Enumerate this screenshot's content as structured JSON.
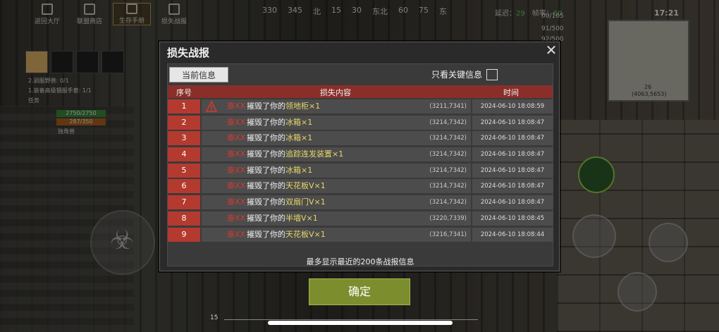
{
  "nav": {
    "items": [
      {
        "label": "返回大厅"
      },
      {
        "label": "联盟商店"
      },
      {
        "label": "生存手册",
        "active": true
      },
      {
        "label": "损失战报"
      }
    ]
  },
  "compass": [
    "330",
    "345",
    "北",
    "15",
    "30",
    "东北",
    "60",
    "75",
    "东"
  ],
  "status": {
    "latency_label": "延迟：",
    "latency_value": "29",
    "fps_label": "帧率：",
    "fps_value": "60",
    "time": "17:21",
    "res1": "91/500",
    "res2": "92/500",
    "res0": "00/165"
  },
  "hud": {
    "task1": "2.驯服野兽: 0/1",
    "task2": "1.装备高级钢服手套: 1/1",
    "task_label": "任务",
    "hp": "2750/2750",
    "ep": "287/350",
    "name": "独角兽",
    "minimap_coords": "(4063,5653)",
    "minimap_num": "26",
    "bottom_level": "15"
  },
  "dialog": {
    "title": "损失战报",
    "tab_current": "当前信息",
    "key_only_label": "只看关键信息",
    "headers": {
      "no": "序号",
      "content": "损失内容",
      "time": "时间"
    },
    "rows": [
      {
        "no": "1",
        "warning": true,
        "attacker": "泰XX",
        "verb": "摧毁了你的",
        "item": "领地柜×1",
        "coord": "(3211,7341)",
        "time": "2024-06-10 18:08:59"
      },
      {
        "no": "2",
        "warning": false,
        "attacker": "泰XX",
        "verb": "摧毁了你的",
        "item": "冰箱×1",
        "coord": "(3214,7342)",
        "time": "2024-06-10 18:08:47"
      },
      {
        "no": "3",
        "warning": false,
        "attacker": "泰XX",
        "verb": "摧毁了你的",
        "item": "冰箱×1",
        "coord": "(3214,7342)",
        "time": "2024-06-10 18:08:47"
      },
      {
        "no": "4",
        "warning": false,
        "attacker": "泰XX",
        "verb": "摧毁了你的",
        "item": "追踪连发装置×1",
        "coord": "(3214,7342)",
        "time": "2024-06-10 18:08:47"
      },
      {
        "no": "5",
        "warning": false,
        "attacker": "泰XX",
        "verb": "摧毁了你的",
        "item": "冰箱×1",
        "coord": "(3214,7342)",
        "time": "2024-06-10 18:08:47"
      },
      {
        "no": "6",
        "warning": false,
        "attacker": "泰XX",
        "verb": "摧毁了你的",
        "item": "天花板V×1",
        "coord": "(3214,7342)",
        "time": "2024-06-10 18:08:47"
      },
      {
        "no": "7",
        "warning": false,
        "attacker": "泰XX",
        "verb": "摧毁了你的",
        "item": "双扇门V×1",
        "coord": "(3214,7342)",
        "time": "2024-06-10 18:08:47"
      },
      {
        "no": "8",
        "warning": false,
        "attacker": "泰XX",
        "verb": "摧毁了你的",
        "item": "半墙V×1",
        "coord": "(3220,7339)",
        "time": "2024-06-10 18:08:45"
      },
      {
        "no": "9",
        "warning": false,
        "attacker": "泰XX",
        "verb": "摧毁了你的",
        "item": "天花板V×1",
        "coord": "(3216,7341)",
        "time": "2024-06-10 18:08:44"
      }
    ],
    "footer_note": "最多显示最近的200条战报信息",
    "confirm_label": "确定"
  },
  "colors": {
    "header_red": "#8a2e2a",
    "row_no_red": "#b43a2f",
    "item_yellow": "#e8d66a",
    "attacker_red": "#d23a30",
    "confirm_green": "#7c8d2e"
  }
}
